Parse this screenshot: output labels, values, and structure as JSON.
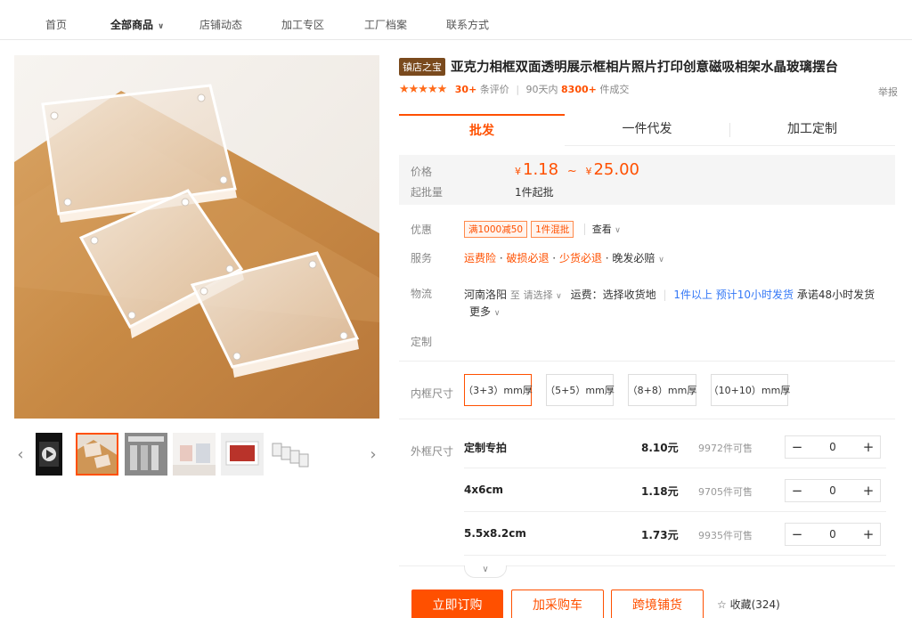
{
  "nav": {
    "items": [
      "首页",
      "全部商品",
      "店铺动态",
      "加工专区",
      "工厂档案",
      "联系方式"
    ],
    "active_index": 1
  },
  "product": {
    "badge": "镇店之宝",
    "title": "亚克力相框双面透明展示框相片照片打印创意磁吸相架水晶玻璃摆台",
    "stars": "★★★★★",
    "review_count": "30+",
    "review_label": "条评价",
    "sales_prefix": "90天内",
    "sales_count": "8300+",
    "sales_suffix": "件成交",
    "report": "举报"
  },
  "tabs": [
    "批发",
    "一件代发",
    "加工定制"
  ],
  "price": {
    "label": "价格",
    "currency": "¥",
    "low": "1.18",
    "sep": "~",
    "high": "25.00",
    "moq_label": "起批量",
    "moq_value": "1件起批"
  },
  "promo": {
    "label": "优惠",
    "tags": [
      "满1000减50",
      "1件混批"
    ],
    "view": "查看"
  },
  "service": {
    "label": "服务",
    "items": [
      "运费险",
      "破损必退",
      "少货必退"
    ],
    "extra": "晚发必赔"
  },
  "logistics": {
    "label": "物流",
    "origin": "河南洛阳",
    "to": "至",
    "select": "请选择",
    "fee": "运费：选择收货地",
    "qty": "1件以上",
    "eta": "预计10小时发货",
    "promise": "承诺48小时发货",
    "more": "更多"
  },
  "custom_label": "定制",
  "inner": {
    "label": "内框尺寸",
    "options": [
      "（3+3）mm厚",
      "（5+5）mm厚",
      "（8+8）mm厚",
      "（10+10）mm厚"
    ],
    "selected_index": 0
  },
  "outer": {
    "label": "外框尺寸",
    "rows": [
      {
        "name": "定制专拍",
        "price": "8.10元",
        "stock": "9972件可售",
        "qty": "0"
      },
      {
        "name": "4x6cm",
        "price": "1.18元",
        "stock": "9705件可售",
        "qty": "0"
      },
      {
        "name": "5.5x8.2cm",
        "price": "1.73元",
        "stock": "9935件可售",
        "qty": "0"
      }
    ]
  },
  "actions": {
    "buy": "立即订购",
    "cart": "加采购车",
    "crossborder": "跨境铺货",
    "favorite": "收藏(324)"
  },
  "colors": {
    "accent": "#ff5000",
    "link": "#3478f6",
    "badge": "#7a4a1d"
  }
}
